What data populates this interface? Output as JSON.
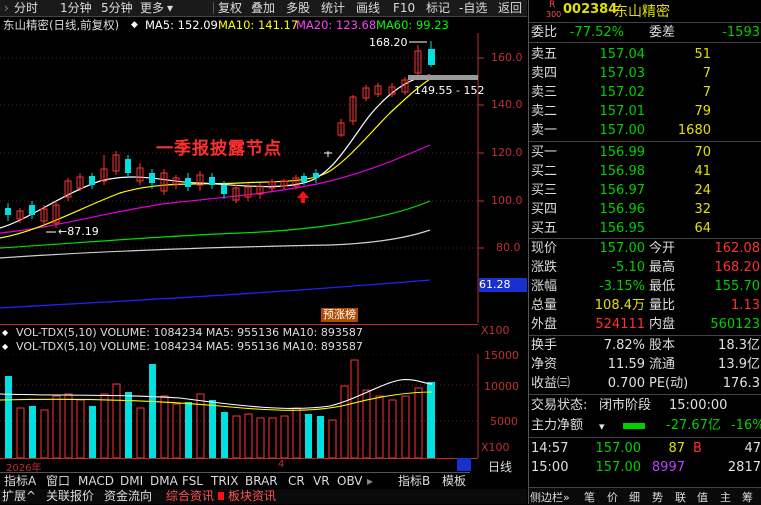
{
  "toolbar": {
    "tabs": [
      "分时",
      "1分钟",
      "5分钟",
      "更多"
    ],
    "chevron": "›",
    "actions": [
      "复权",
      "叠加",
      "多股",
      "统计",
      "画线",
      "F10",
      "标记",
      "-自选",
      "返回"
    ]
  },
  "chart": {
    "title": "东山精密(日线,前复权)",
    "ma5": "MA5: 152.09",
    "ma10": "MA10: 141.17",
    "ma20": "MA20: 123.68",
    "ma60": "MA60: 99.23",
    "high_label": "168.20",
    "right_label": "149.55 - 152",
    "low_label": "←87.19",
    "annotation": "一季报披露节点",
    "badge": "预涨榜",
    "current_price_tag": "61.28",
    "scale_tag": "X100",
    "y_ticks": [
      "160.0",
      "140.0",
      "120.0",
      "100.0",
      "80.0"
    ],
    "colors": {
      "up": "#ff3232",
      "down": "#00ffff",
      "ma5": "#ffffff",
      "ma10": "#ffff00",
      "ma20": "#ff00ff",
      "ma60": "#00ff00"
    }
  },
  "volume": {
    "line1": "VOL-TDX(5,10) VOLUME: 1084234 MA5: 955136 MA10: 893587",
    "line2": "VOL-TDX(5,10) VOLUME: 1084234 MA5: 955136 MA10: 893587",
    "y_ticks": [
      "15000",
      "10000",
      "5000"
    ],
    "scale_tag": "X100"
  },
  "time_axis": {
    "year": "2026年",
    "month": "4"
  },
  "bottom_tabs": [
    "指标A",
    "窗口",
    "MACD",
    "DMI",
    "DMA",
    "FSL",
    "TRIX",
    "BRAR",
    "CR",
    "VR",
    "OBV",
    "指标B",
    "模板",
    "日线"
  ],
  "status_tabs": [
    "扩展^",
    "关联报价",
    "资金流向",
    "综合资讯",
    "板块资讯"
  ],
  "quote": {
    "market": "R",
    "market_sub": "300",
    "code": "002384",
    "name": "东山精密",
    "webi_label": "委比",
    "webi": "-77.52%",
    "weicha_label": "委差",
    "weicha": "-1593",
    "asks": [
      {
        "label": "卖五",
        "price": "157.04",
        "vol": "51"
      },
      {
        "label": "卖四",
        "price": "157.03",
        "vol": "7"
      },
      {
        "label": "卖三",
        "price": "157.02",
        "vol": "7"
      },
      {
        "label": "卖二",
        "price": "157.01",
        "vol": "79"
      },
      {
        "label": "卖一",
        "price": "157.00",
        "vol": "1680"
      }
    ],
    "bids": [
      {
        "label": "买一",
        "price": "156.99",
        "vol": "70"
      },
      {
        "label": "买二",
        "price": "156.98",
        "vol": "41"
      },
      {
        "label": "买三",
        "price": "156.97",
        "vol": "24"
      },
      {
        "label": "买四",
        "price": "156.96",
        "vol": "32"
      },
      {
        "label": "买五",
        "price": "156.95",
        "vol": "64"
      }
    ],
    "stats": [
      {
        "l1": "现价",
        "v1": "157.00",
        "c1": "grn",
        "l2": "今开",
        "v2": "162.08",
        "c2": "red"
      },
      {
        "l1": "涨跌",
        "v1": "-5.10",
        "c1": "grn",
        "l2": "最高",
        "v2": "168.20",
        "c2": "red"
      },
      {
        "l1": "涨幅",
        "v1": "-3.15%",
        "c1": "grn",
        "l2": "最低",
        "v2": "155.70",
        "c2": "grn"
      },
      {
        "l1": "总量",
        "v1": "108.4万",
        "c1": "yel",
        "l2": "量比",
        "v2": "1.13",
        "c2": "red"
      },
      {
        "l1": "外盘",
        "v1": "524111",
        "c1": "red",
        "l2": "内盘",
        "v2": "560123",
        "c2": "grn"
      }
    ],
    "stats2": [
      {
        "l1": "换手",
        "v1": "7.82%",
        "l2": "股本",
        "v2": "18.3亿"
      },
      {
        "l1": "净资",
        "v1": "11.59",
        "l2": "流通",
        "v2": "13.9亿"
      },
      {
        "l1": "收益㈢",
        "v1": "0.700",
        "l2": "PE(动)",
        "v2": "176.3"
      }
    ],
    "trade_status_label": "交易状态:",
    "trade_status": "闭市阶段",
    "trade_time": "15:00:00",
    "main_flow_label": "主力净额",
    "main_flow": "-27.67亿",
    "main_flow_pct": "-16%",
    "ticks": [
      {
        "time": "14:57",
        "price": "157.00",
        "vol": "87",
        "flag": "B",
        "extra": "47"
      },
      {
        "time": "15:00",
        "price": "157.00",
        "vol": "8997",
        "flag": "",
        "extra": "2817"
      }
    ],
    "right_tabs": [
      "侧边栏»",
      "笔",
      "价",
      "细",
      "势",
      "联",
      "值",
      "主",
      "筹"
    ]
  }
}
